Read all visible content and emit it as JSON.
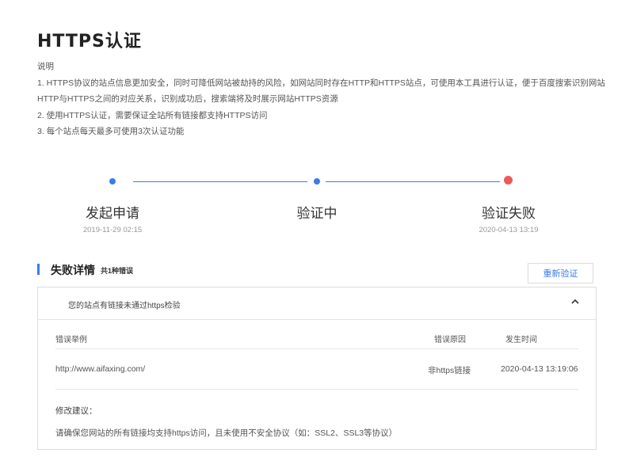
{
  "page": {
    "title": "HTTPS认证",
    "description": {
      "heading": "说明",
      "lines": [
        "1. HTTPS协议的站点信息更加安全，同时可降低网站被劫持的风险，如网站同时存在HTTP和HTTPS站点，可使用本工具进行认证，便于百度搜索识别网站",
        "HTTP与HTTPS之间的对应关系，识别成功后，搜索端将及时展示网站HTTPS资源",
        "2. 使用HTTPS认证，需要保证全站所有链接都支持HTTPS访问",
        "3. 每个站点每天最多可使用3次认证功能"
      ]
    }
  },
  "steps": [
    {
      "label": "发起申请",
      "time": "2019-11-29 02:15",
      "status": "done",
      "color": "#3a7ce8"
    },
    {
      "label": "验证中",
      "time": "",
      "status": "done",
      "color": "#3a7ce8"
    },
    {
      "label": "验证失败",
      "time": "2020-04-13 13:19",
      "status": "failed",
      "color": "#ee5a5a"
    }
  ],
  "failure": {
    "title": "失败详情",
    "count_label": "共1种错误",
    "retry_label": "重新验证",
    "panel": {
      "header": "您的站点有链接未通过https检验",
      "columns": [
        "错误举例",
        "错误原因",
        "发生时间"
      ],
      "rows": [
        {
          "example": "http://www.aifaxing.com/",
          "reason": "非https链接",
          "time": "2020-04-13 13:19:06"
        }
      ],
      "suggestion_title": "修改建议：",
      "suggestion_text": "请确保您网站的所有链接均支持https访问，且未使用不安全协议（如：SSL2、SSL3等协议）"
    }
  },
  "colors": {
    "accent": "#3a7ce8",
    "error": "#ee5a5a"
  }
}
